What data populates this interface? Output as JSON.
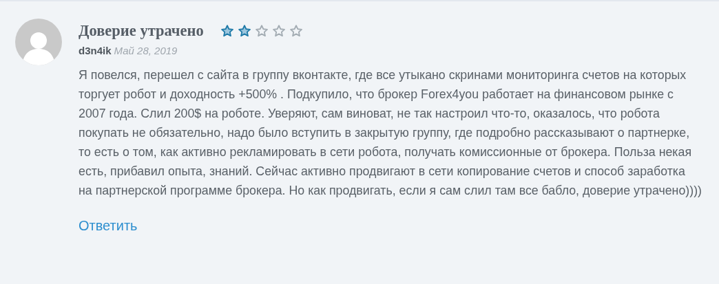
{
  "review": {
    "title": "Доверие утрачено",
    "stars": 2,
    "author": "d3n4ik",
    "date": "Май 28, 2019",
    "text": "Я повелся, перешел с сайта в группу вконтакте, где все утыкано скринами мониторинга счетов на которых торгует робот и доходность +500% . Подкупило, что брокер Forex4you работает на финансовом рынке с 2007 года. Слил 200$ на роботе. Уверяют, сам виноват, не так настроил что-то, оказалось, что робота покупать не обязательно, надо было вступить в закрытую группу, где подробно рассказывают о партнерке, то есть о том, как активно рекламировать в сети робота, получать комиссионные от брокера. Польза некая есть, прибавил опыта, знаний. Сейчас активно продвигают в сети копирование счетов и способ заработка на партнерской программе брокера. Но как продвигать, если я сам слил там все бабло, доверие утрачено))))",
    "reply": "Ответить"
  }
}
